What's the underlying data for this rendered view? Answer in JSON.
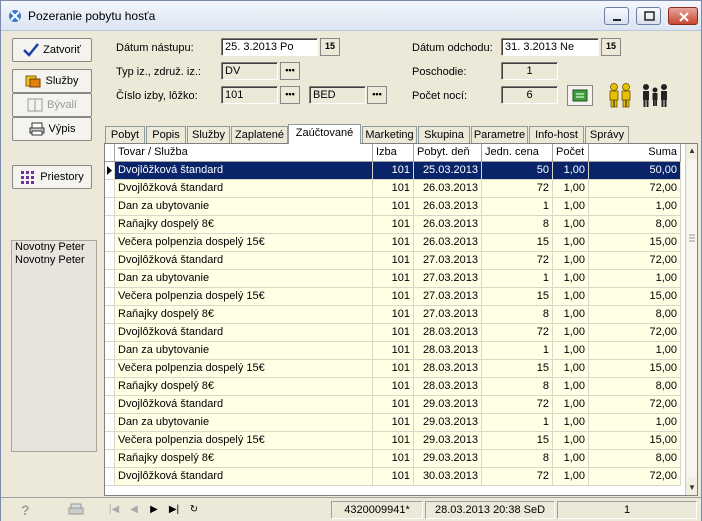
{
  "window": {
    "title": "Pozeranie pobytu hosťa"
  },
  "left_buttons": {
    "close": "Zatvoriť",
    "services": "Služby",
    "residents": "Bývalí",
    "print": "Výpis",
    "spaces": "Priestory"
  },
  "guests": [
    "Novotny Peter",
    "Novotny Peter"
  ],
  "form": {
    "arrival_label": "Dátum nástupu:",
    "arrival_value": "25. 3.2013  Po",
    "departure_label": "Dátum odchodu:",
    "departure_value": "31. 3.2013  Ne",
    "type_label": "Typ iz., združ. iz.:",
    "type_value": "DV",
    "floor_label": "Poschodie:",
    "floor_value": "1",
    "room_label": "Číslo izby, lôžko:",
    "room_value": "101",
    "bed_value": "BED",
    "nights_label": "Počet nocí:",
    "nights_value": "6",
    "calendar_button": "15",
    "lookup_button": "•••"
  },
  "tabs": [
    {
      "label": "Pobyt"
    },
    {
      "label": "Popis"
    },
    {
      "label": "Služby"
    },
    {
      "label": "Zaplatené"
    },
    {
      "label": "Zaúčtované"
    },
    {
      "label": "Marketing"
    },
    {
      "label": "Skupina"
    },
    {
      "label": "Parametre"
    },
    {
      "label": "Info-host"
    },
    {
      "label": "Správy"
    }
  ],
  "active_tab": "Zaúčtované",
  "table": {
    "headers": [
      "Tovar / Služba",
      "Izba",
      "Pobyt. deň",
      "Jedn. cena",
      "Počet",
      "Suma"
    ],
    "rows": [
      [
        "Dvojlôžková štandard",
        "101",
        "25.03.2013",
        "50",
        "1,00",
        "50,00"
      ],
      [
        "Dvojlôžková štandard",
        "101",
        "26.03.2013",
        "72",
        "1,00",
        "72,00"
      ],
      [
        "Dan za ubytovanie",
        "101",
        "26.03.2013",
        "1",
        "1,00",
        "1,00"
      ],
      [
        "Raňajky dospelý 8€",
        "101",
        "26.03.2013",
        "8",
        "1,00",
        "8,00"
      ],
      [
        "Večera polpenzia dospelý 15€",
        "101",
        "26.03.2013",
        "15",
        "1,00",
        "15,00"
      ],
      [
        "Dvojlôžková štandard",
        "101",
        "27.03.2013",
        "72",
        "1,00",
        "72,00"
      ],
      [
        "Dan za ubytovanie",
        "101",
        "27.03.2013",
        "1",
        "1,00",
        "1,00"
      ],
      [
        "Večera polpenzia dospelý 15€",
        "101",
        "27.03.2013",
        "15",
        "1,00",
        "15,00"
      ],
      [
        "Raňajky dospelý 8€",
        "101",
        "27.03.2013",
        "8",
        "1,00",
        "8,00"
      ],
      [
        "Dvojlôžková štandard",
        "101",
        "28.03.2013",
        "72",
        "1,00",
        "72,00"
      ],
      [
        "Dan za ubytovanie",
        "101",
        "28.03.2013",
        "1",
        "1,00",
        "1,00"
      ],
      [
        "Večera polpenzia dospelý 15€",
        "101",
        "28.03.2013",
        "15",
        "1,00",
        "15,00"
      ],
      [
        "Raňajky dospelý 8€",
        "101",
        "28.03.2013",
        "8",
        "1,00",
        "8,00"
      ],
      [
        "Dvojlôžková štandard",
        "101",
        "29.03.2013",
        "72",
        "1,00",
        "72,00"
      ],
      [
        "Dan za ubytovanie",
        "101",
        "29.03.2013",
        "1",
        "1,00",
        "1,00"
      ],
      [
        "Večera polpenzia dospelý 15€",
        "101",
        "29.03.2013",
        "15",
        "1,00",
        "15,00"
      ],
      [
        "Raňajky dospelý 8€",
        "101",
        "29.03.2013",
        "8",
        "1,00",
        "8,00"
      ],
      [
        "Dvojlôžková štandard",
        "101",
        "30.03.2013",
        "72",
        "1,00",
        "72,00"
      ]
    ]
  },
  "status": {
    "record_id": "4320009941*",
    "timestamp": "28.03.2013 20:38 SeD",
    "page": "1"
  },
  "colors": {
    "selection": "#0a246a",
    "row_bg": "#ffffe6",
    "window_bg": "#ece9d8"
  }
}
